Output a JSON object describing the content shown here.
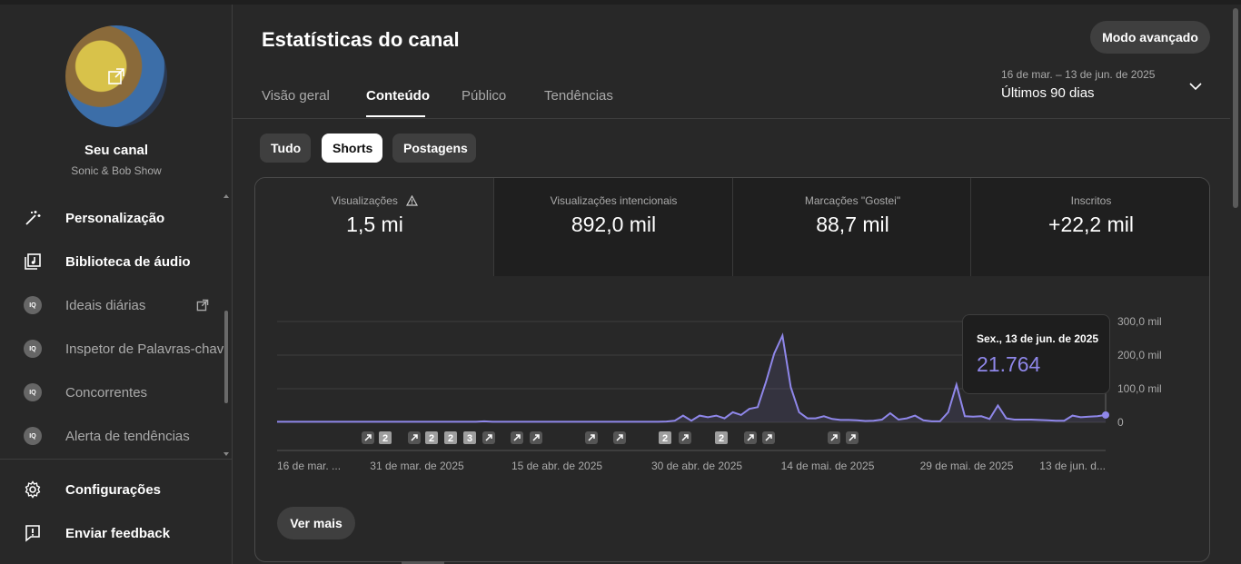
{
  "sidebar": {
    "channel_name": "Seu canal",
    "channel_handle": "Sonic & Bob Show",
    "nav": [
      {
        "label": "Personalização",
        "icon": "magic-wand-icon",
        "style": "strong"
      },
      {
        "label": "Biblioteca de áudio",
        "icon": "audio-library-icon",
        "style": "strong"
      },
      {
        "label": "Ideais diárias",
        "icon": "vidiq-icon",
        "style": "dim"
      },
      {
        "label": "Inspetor de Palavras-chav",
        "icon": "vidiq-icon",
        "style": "dim"
      },
      {
        "label": "Concorrentes",
        "icon": "vidiq-icon",
        "style": "dim"
      },
      {
        "label": "Alerta de tendências",
        "icon": "vidiq-icon",
        "style": "dim"
      }
    ],
    "iq_badge": "IQ",
    "settings_label": "Configurações",
    "feedback_label": "Enviar feedback"
  },
  "header": {
    "title": "Estatísticas do canal",
    "advanced_button": "Modo avançado",
    "date_range": "16 de mar. – 13 de jun. de 2025",
    "date_label": "Últimos 90 dias"
  },
  "tabs": [
    "Visão geral",
    "Conteúdo",
    "Público",
    "Tendências"
  ],
  "active_tab": "Conteúdo",
  "chips": [
    "Tudo",
    "Shorts",
    "Postagens"
  ],
  "active_chip": "Shorts",
  "metrics": [
    {
      "label": "Visualizações",
      "value": "1,5 mi",
      "warning": true
    },
    {
      "label": "Visualizações intencionais",
      "value": "892,0 mil"
    },
    {
      "label": "Marcações \"Gostei\"",
      "value": "88,7 mil"
    },
    {
      "label": "Inscritos",
      "value": "+22,2 mil"
    }
  ],
  "tooltip": {
    "date": "Sex., 13 de jun. de 2025",
    "value": "21.764"
  },
  "see_more": "Ver mais",
  "colors": {
    "line": "#8f87ea",
    "background": "#282828",
    "panel": "#1f1f1f"
  },
  "chart_data": {
    "type": "area",
    "x_start": "2025-03-16",
    "x_end": "2025-06-13",
    "x_ticks": [
      "16 de mar. ...",
      "31 de mar. de 2025",
      "15 de abr. de 2025",
      "30 de abr. de 2025",
      "14 de mai. de 2025",
      "29 de mai. de 2025",
      "13 de jun. d..."
    ],
    "y_ticks": [
      "0",
      "100,0 mil",
      "200,0 mil",
      "300,0 mil"
    ],
    "ylim": [
      0,
      300000
    ],
    "values": [
      500,
      500,
      500,
      500,
      500,
      500,
      500,
      500,
      500,
      500,
      500,
      500,
      500,
      500,
      500,
      500,
      500,
      500,
      500,
      500,
      500,
      500,
      500,
      500,
      500,
      500,
      500,
      500,
      500,
      500,
      500,
      500,
      500,
      500,
      500,
      500,
      500,
      500,
      500,
      500,
      500,
      500,
      500,
      500,
      500,
      500,
      500,
      500,
      500,
      500,
      500,
      500,
      500,
      500,
      500,
      500,
      500,
      500,
      500,
      500,
      500,
      500,
      500,
      500,
      500,
      500,
      500,
      500,
      500,
      500,
      500,
      500,
      500,
      500,
      500,
      500,
      500,
      500,
      500,
      500,
      500,
      500,
      500,
      500,
      500,
      500,
      500,
      500,
      500,
      500
    ],
    "series_values": [
      1500,
      1500,
      1500,
      1500,
      1500,
      1500,
      1500,
      1500,
      1500,
      1500,
      1500,
      1500,
      1500,
      1500,
      1500,
      1500,
      1500,
      1500,
      1500,
      1500,
      1500,
      1500,
      1500,
      1500,
      1500,
      3000,
      1500,
      1500,
      1500,
      1500,
      1500,
      1500,
      1500,
      1500,
      1500,
      1500,
      1500,
      1500,
      1500,
      1500,
      1500,
      1500,
      1500,
      1500,
      1500,
      1500,
      1500,
      2500,
      5000,
      20000,
      5000,
      20000,
      15000,
      20000,
      12000,
      30000,
      22000,
      40000,
      45000,
      120000,
      205000,
      258000,
      105000,
      30000,
      12000,
      12000,
      18000,
      10000,
      7000,
      7000,
      6000,
      4000,
      5000,
      8000,
      27000,
      8000,
      12000,
      20000,
      6000,
      3000,
      3000,
      30000,
      112000,
      18000,
      17000,
      18000,
      10000,
      50000,
      12000,
      8000,
      8000,
      8000,
      7000,
      6000,
      5000,
      5000,
      20000,
      15000,
      17000,
      18000,
      21764
    ],
    "markers": [
      {
        "type": "short"
      },
      {
        "type": "count",
        "label": "2"
      },
      {
        "type": "short"
      },
      {
        "type": "count",
        "label": "2"
      },
      {
        "type": "count",
        "label": "2"
      },
      {
        "type": "count",
        "label": "3"
      },
      {
        "type": "short"
      },
      {
        "type": "short"
      },
      {
        "type": "short"
      },
      {
        "type": "short"
      },
      {
        "type": "short"
      },
      {
        "type": "count",
        "label": "2"
      },
      {
        "type": "short"
      },
      {
        "type": "count",
        "label": "2"
      },
      {
        "type": "short"
      },
      {
        "type": "short"
      },
      {
        "type": "short"
      },
      {
        "type": "short"
      }
    ]
  }
}
